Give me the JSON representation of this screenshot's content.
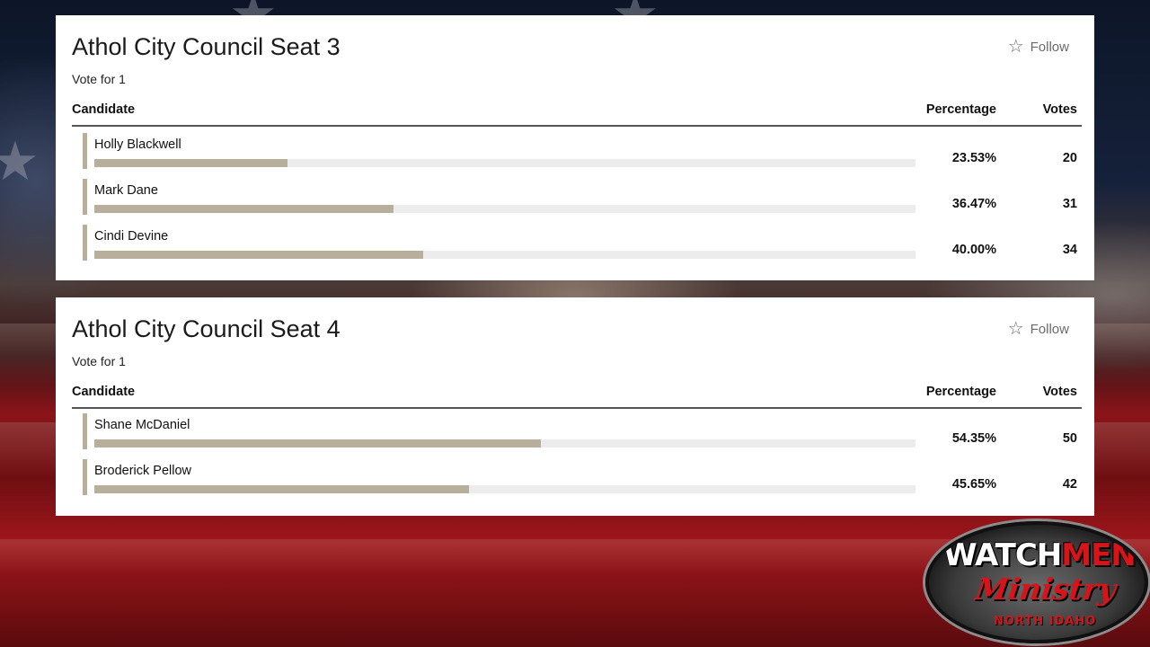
{
  "races": [
    {
      "title": "Athol City Council Seat 3",
      "subtitle": "Vote for 1",
      "follow_label": "Follow",
      "columns": {
        "candidate": "Candidate",
        "percentage": "Percentage",
        "votes": "Votes"
      },
      "candidates": [
        {
          "name": "Holly Blackwell",
          "percentage": "23.53%",
          "share": 0.2353,
          "votes": "20"
        },
        {
          "name": "Mark Dane",
          "percentage": "36.47%",
          "share": 0.3647,
          "votes": "31"
        },
        {
          "name": "Cindi Devine",
          "percentage": "40.00%",
          "share": 0.4,
          "votes": "34"
        }
      ]
    },
    {
      "title": "Athol City Council Seat 4",
      "subtitle": "Vote for 1",
      "follow_label": "Follow",
      "columns": {
        "candidate": "Candidate",
        "percentage": "Percentage",
        "votes": "Votes"
      },
      "candidates": [
        {
          "name": "Shane McDaniel",
          "percentage": "54.35%",
          "share": 0.5435,
          "votes": "50"
        },
        {
          "name": "Broderick Pellow",
          "percentage": "45.65%",
          "share": 0.4565,
          "votes": "42"
        }
      ]
    }
  ],
  "colors": {
    "bar_fill": "#b8ae9c",
    "bar_track": "#ececec",
    "logo_red": "#d8141b"
  },
  "icons": {
    "follow": "star-outline-icon"
  },
  "logo": {
    "line1_white": "WATCH",
    "line1_red": "MEN",
    "line2": "Ministry",
    "line3": "NORTH IDAHO"
  }
}
